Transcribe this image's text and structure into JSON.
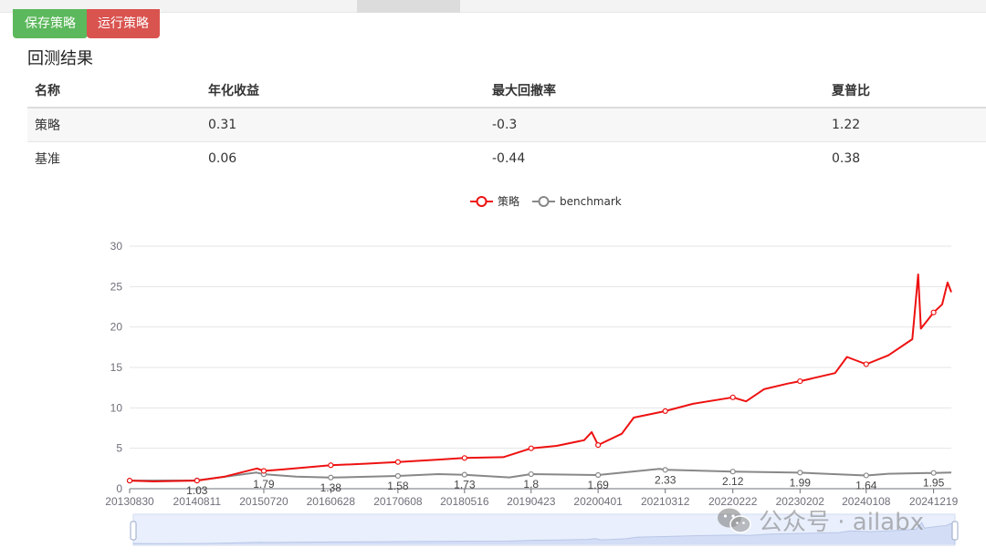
{
  "toolbar": {
    "save_label": "保存策略",
    "run_label": "运行策略"
  },
  "section_title": "回测结果",
  "table": {
    "headers": [
      "名称",
      "年化收益",
      "最大回撤率",
      "夏普比"
    ],
    "rows": [
      [
        "策略",
        "0.31",
        "-0.3",
        "1.22"
      ],
      [
        "基准",
        "0.06",
        "-0.44",
        "0.38"
      ]
    ]
  },
  "watermark": "公众号 · ailabx",
  "chart_data": {
    "type": "line",
    "title": "",
    "xlabel": "",
    "ylabel": "",
    "ylim": [
      0,
      30
    ],
    "yticks": [
      0,
      5,
      10,
      15,
      20,
      25,
      30
    ],
    "grid": true,
    "legend_position": "top-center",
    "x_tick_labels": [
      "20130830",
      "20140811",
      "20150720",
      "20160628",
      "20170608",
      "20180516",
      "20190423",
      "20200401",
      "20210312",
      "20220222",
      "20230202",
      "20240108",
      "20241219"
    ],
    "series": [
      {
        "name": "策略",
        "color": "#ee1111",
        "points": [
          [
            "20130830",
            1.0
          ],
          [
            "20140101",
            0.9
          ],
          [
            "20140811",
            1.0
          ],
          [
            "20150101",
            1.5
          ],
          [
            "20150615",
            2.5
          ],
          [
            "20150720",
            2.2
          ],
          [
            "20151101",
            2.4
          ],
          [
            "20160628",
            2.9
          ],
          [
            "20170101",
            3.1
          ],
          [
            "20170608",
            3.3
          ],
          [
            "20180101",
            3.6
          ],
          [
            "20180516",
            3.8
          ],
          [
            "20181201",
            3.9
          ],
          [
            "20190423",
            5.0
          ],
          [
            "20190901",
            5.3
          ],
          [
            "20200120",
            6.0
          ],
          [
            "20200228",
            7.0
          ],
          [
            "20200401",
            5.4
          ],
          [
            "20200801",
            6.8
          ],
          [
            "20201001",
            8.8
          ],
          [
            "20210312",
            9.6
          ],
          [
            "20210801",
            10.5
          ],
          [
            "20220222",
            11.3
          ],
          [
            "20220501",
            10.8
          ],
          [
            "20220801",
            12.3
          ],
          [
            "20221201",
            13.0
          ],
          [
            "20230202",
            13.3
          ],
          [
            "20230801",
            14.3
          ],
          [
            "20231001",
            16.3
          ],
          [
            "20240108",
            15.4
          ],
          [
            "20240501",
            16.5
          ],
          [
            "20240901",
            18.5
          ],
          [
            "20241001",
            26.5
          ],
          [
            "20241015",
            19.8
          ],
          [
            "20241219",
            21.8
          ],
          [
            "20250201",
            22.8
          ],
          [
            "20250301",
            25.5
          ],
          [
            "20250320",
            24.3
          ]
        ]
      },
      {
        "name": "benchmark",
        "color": "#888888",
        "points": [
          [
            "20130830",
            1.0
          ],
          [
            "20140811",
            1.03
          ],
          [
            "20150612",
            2.0
          ],
          [
            "20150720",
            1.79
          ],
          [
            "20160101",
            1.5
          ],
          [
            "20160628",
            1.38
          ],
          [
            "20170608",
            1.58
          ],
          [
            "20180101",
            1.8
          ],
          [
            "20180516",
            1.73
          ],
          [
            "20190101",
            1.4
          ],
          [
            "20190423",
            1.8
          ],
          [
            "20200401",
            1.69
          ],
          [
            "20210210",
            2.45
          ],
          [
            "20210312",
            2.33
          ],
          [
            "20220222",
            2.12
          ],
          [
            "20230202",
            1.99
          ],
          [
            "20240108",
            1.64
          ],
          [
            "20240501",
            1.85
          ],
          [
            "20241219",
            1.95
          ],
          [
            "20250320",
            2.0
          ]
        ]
      }
    ],
    "point_labels": [
      {
        "series": 1,
        "x": "20140811",
        "text": "1.03"
      },
      {
        "series": 1,
        "x": "20150720",
        "text": "1.79"
      },
      {
        "series": 1,
        "x": "20160628",
        "text": "1.38"
      },
      {
        "series": 1,
        "x": "20170608",
        "text": "1.58"
      },
      {
        "series": 1,
        "x": "20180516",
        "text": "1.73"
      },
      {
        "series": 1,
        "x": "20190423",
        "text": "1.8"
      },
      {
        "series": 1,
        "x": "20200401",
        "text": "1.69"
      },
      {
        "series": 1,
        "x": "20210312",
        "text": "2.33"
      },
      {
        "series": 1,
        "x": "20220222",
        "text": "2.12"
      },
      {
        "series": 1,
        "x": "20230202",
        "text": "1.99"
      },
      {
        "series": 1,
        "x": "20240108",
        "text": "1.64"
      },
      {
        "series": 1,
        "x": "20241219",
        "text": "1.95"
      }
    ]
  }
}
